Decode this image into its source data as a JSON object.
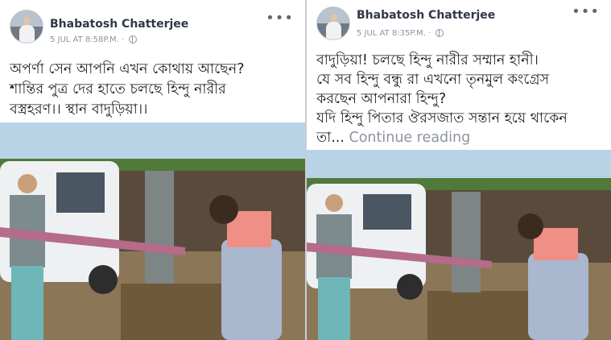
{
  "posts": [
    {
      "author": "Bhabatosh Chatterjee",
      "timestamp": "5 JUL AT 8:58P.M.",
      "text_lines": [
        "অপর্ণা সেন আপনি এখন কোথায় আছেন?",
        "শান্তির পুত্র দের হাতে চলছে হিন্দু নারীর",
        "বস্ত্রহরণ।। স্থান বাদুড়িয়া।।"
      ],
      "continue_label": ""
    },
    {
      "author": "Bhabatosh Chatterjee",
      "timestamp": "5 JUL AT 8:35P.M.",
      "text_lines": [
        "বাদুড়িয়া! চলছে হিন্দু নারীর সম্মান হানী।",
        "যে সব হিন্দু বন্ধু রা এখনো তৃনমুল কংগ্রেস",
        "করছেন আপনারা হিন্দু?",
        "যদি হিন্দু পিতার ঔরসজাত সন্তান হয়ে থাকেন",
        "তা..."
      ],
      "continue_label": "Continue reading"
    }
  ],
  "icons": {
    "more": "more-options-icon",
    "audience": "globe-icon",
    "profile": "avatar"
  },
  "colors": {
    "author": "#2f3747",
    "meta": "#8d949e",
    "body_text": "#1c1e21",
    "continue": "#8d949e"
  }
}
